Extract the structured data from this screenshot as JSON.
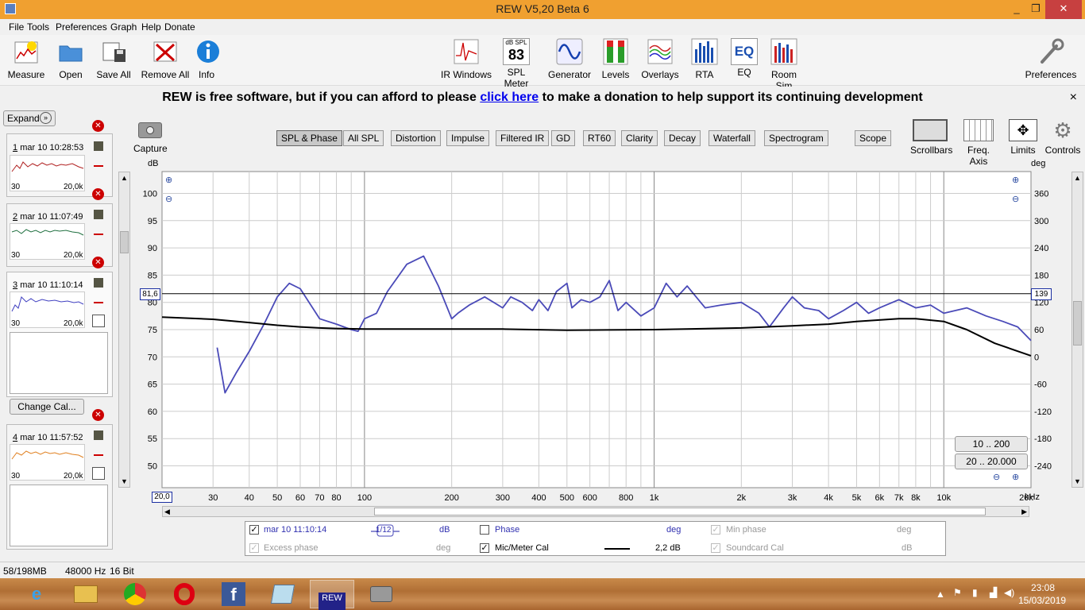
{
  "window": {
    "title": "REW V5,20 Beta 6",
    "minimize": "_",
    "restore": "❐",
    "close": "✕"
  },
  "menu": [
    "File",
    "Tools",
    "Preferences",
    "Graph",
    "Help",
    "Donate"
  ],
  "toolbar": {
    "left": [
      "Measure",
      "Open",
      "Save All",
      "Remove All",
      "Info"
    ],
    "center": [
      "IR Windows",
      "SPL Meter",
      "Generator",
      "Levels",
      "Overlays",
      "RTA",
      "EQ",
      "Room Sim"
    ],
    "spl_meter_unit": "dB SPL",
    "spl_meter_value": "83",
    "right": "Preferences"
  },
  "banner": {
    "before": "REW is free software, but if you can afford to please",
    "link": "click here",
    "after": "to make a donation to help support its continuing development",
    "close": "×"
  },
  "panel": {
    "expand": "Expand",
    "change_cal": "Change Cal...",
    "measurements": [
      {
        "num": "1",
        "name": "mar 10 10:28:53",
        "color": "#b02020",
        "xmin": "30",
        "xmax": "20,0k"
      },
      {
        "num": "2",
        "name": "mar 10 11:07:49",
        "color": "#207040",
        "xmin": "30",
        "xmax": "20,0k"
      },
      {
        "num": "3",
        "name": "mar 10 11:10:14",
        "color": "#4040c0",
        "xmin": "30",
        "xmax": "20,0k"
      },
      {
        "num": "4",
        "name": "mar 10 11:57:52",
        "color": "#e08020",
        "xmin": "30",
        "xmax": "20,0k"
      }
    ]
  },
  "graph": {
    "capture": "Capture",
    "tabs": [
      "SPL & Phase",
      "All SPL",
      "Distortion",
      "Impulse",
      "Filtered IR",
      "GD",
      "RT60",
      "Clarity",
      "Decay",
      "Waterfall",
      "Spectrogram",
      "Scope"
    ],
    "active_tab": "SPL & Phase",
    "controls": [
      "Scrollbars",
      "Freq. Axis",
      "Limits",
      "Controls"
    ],
    "left_unit": "dB",
    "right_unit": "deg",
    "cursor_db": "81,6",
    "cursor_deg": "139",
    "cursor_freq": "20,0",
    "x_unit": "kHz",
    "range_buttons": [
      "10 .. 200",
      "20 .. 20.000"
    ],
    "y_ticks": [
      "100",
      "95",
      "90",
      "85",
      "80",
      "75",
      "70",
      "65",
      "60",
      "55",
      "50"
    ],
    "deg_ticks": [
      "360",
      "300",
      "240",
      "180",
      "120",
      "60",
      "0",
      "-60",
      "-120",
      "-180",
      "-240"
    ],
    "x_ticks": [
      "30",
      "40",
      "50",
      "60",
      "70",
      "80",
      "100",
      "200",
      "300",
      "400",
      "500",
      "600",
      "800",
      "1k",
      "2k",
      "3k",
      "4k",
      "5k",
      "6k",
      "7k",
      "8k",
      "10k",
      "20k"
    ]
  },
  "chart_data": {
    "type": "line",
    "xscale": "log",
    "xlim": [
      20,
      20000
    ],
    "ylim": [
      46,
      104
    ],
    "x_ticks": [
      "30",
      "40",
      "50",
      "60",
      "70",
      "80",
      "100",
      "200",
      "300",
      "400",
      "500",
      "600",
      "800",
      "1k",
      "2k",
      "3k",
      "4k",
      "5k",
      "6k",
      "7k",
      "8k",
      "10k",
      "20k"
    ],
    "y_ticks": [
      100,
      95,
      90,
      85,
      80,
      75,
      70,
      65,
      60,
      55,
      50
    ],
    "series": [
      {
        "name": "mar 10 11:10:14",
        "color": "#4a4ab8",
        "x": [
          31,
          33,
          36,
          40,
          45,
          50,
          55,
          60,
          70,
          80,
          90,
          95,
          100,
          110,
          120,
          140,
          160,
          180,
          200,
          210,
          230,
          260,
          300,
          320,
          350,
          380,
          400,
          430,
          460,
          500,
          520,
          560,
          600,
          650,
          700,
          750,
          800,
          900,
          1000,
          1100,
          1200,
          1300,
          1500,
          1700,
          2000,
          2300,
          2500,
          2800,
          3000,
          3300,
          3700,
          4000,
          4500,
          5000,
          5500,
          6000,
          7000,
          8000,
          9000,
          10000,
          12000,
          14000,
          16000,
          18000,
          20000
        ],
        "y": [
          71.7,
          63.4,
          67,
          71,
          76,
          81,
          83.5,
          82.5,
          77,
          76,
          75,
          74.7,
          77,
          78,
          82,
          87,
          88.5,
          83,
          77,
          78,
          79.5,
          81,
          79,
          81,
          80,
          78.5,
          80.5,
          78.5,
          82,
          83.5,
          79,
          80.5,
          80,
          81,
          84,
          78.5,
          80,
          77.5,
          79,
          83.5,
          81,
          83,
          79,
          79.5,
          80,
          78,
          75.5,
          79,
          81,
          79,
          78.5,
          77,
          78.5,
          80,
          78,
          79,
          80.5,
          79,
          79.5,
          78,
          79,
          77.5,
          76.5,
          75.5,
          73
        ]
      },
      {
        "name": "Mic/Meter Cal",
        "color": "#000000",
        "x": [
          20,
          30,
          40,
          50,
          60,
          70,
          80,
          100,
          200,
          300,
          500,
          1000,
          2000,
          3000,
          4000,
          5000,
          7000,
          8000,
          10000,
          12000,
          15000,
          20000
        ],
        "y": [
          77.3,
          76.9,
          76.3,
          75.8,
          75.5,
          75.3,
          75.2,
          75.1,
          75.1,
          75.1,
          74.9,
          75,
          75.3,
          75.7,
          76,
          76.5,
          77,
          77,
          76.5,
          75,
          72.5,
          70.2
        ]
      }
    ]
  },
  "legend": {
    "row1": [
      {
        "label": "mar 10 11:10:14",
        "checked": true,
        "unit": "dB",
        "smoothing": "1/12"
      },
      {
        "label": "Phase",
        "checked": false,
        "unit": "deg"
      },
      {
        "label": "Min phase",
        "checked": true,
        "disabled": true,
        "unit": "deg"
      }
    ],
    "row2": [
      {
        "label": "Excess phase",
        "checked": true,
        "disabled": true,
        "unit": "deg"
      },
      {
        "label": "Mic/Meter Cal",
        "checked": true,
        "value": "2,2 dB"
      },
      {
        "label": "Soundcard Cal",
        "checked": true,
        "disabled": true,
        "unit": "dB"
      }
    ]
  },
  "status": {
    "memory": "58/198MB",
    "rate": "48000 Hz",
    "bits": "16 Bit"
  },
  "taskbar": {
    "apps": [
      "Internet Explorer",
      "File Explorer",
      "Chrome",
      "Opera",
      "Facebook",
      "Notepad",
      "REW",
      "Camera"
    ],
    "active": "REW",
    "rew_label": "REW",
    "time": "23:08",
    "date": "15/03/2019"
  },
  "colors": {
    "title_bar": "#f0a030",
    "graph_bg": "#ffffff",
    "grid": "#cccccc",
    "active_tab": "#c8c8c8"
  }
}
